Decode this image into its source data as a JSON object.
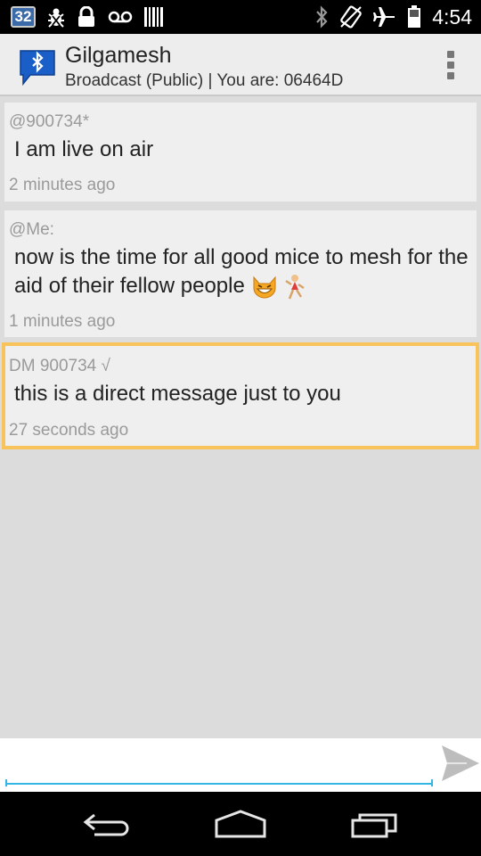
{
  "status_bar": {
    "notification_count": "32",
    "time": "4:54",
    "left_icons": [
      "bug-icon",
      "lock-icon",
      "voicemail-icon",
      "barcode-icon"
    ],
    "right_icons": [
      "bluetooth-icon",
      "no-rotate-icon",
      "airplane-icon",
      "battery-icon"
    ]
  },
  "action_bar": {
    "title": "Gilgamesh",
    "subtitle": "Broadcast (Public) | You are: 06464D",
    "icon": "bluetooth-chat-icon",
    "overflow_icon": "overflow-menu-icon"
  },
  "messages": [
    {
      "sender": "@900734*",
      "text": "I am live on air",
      "time": "2 minutes ago",
      "direct": false
    },
    {
      "sender": "@Me:",
      "text": "now is the time for all good mice to mesh for the aid of their fellow people",
      "emojis": [
        "grinning-cat-emoji",
        "dancer-emoji"
      ],
      "time": "1 minutes ago",
      "direct": false
    },
    {
      "sender": "DM 900734 √",
      "text": "this is a direct message just to you",
      "time": "27 seconds ago",
      "direct": true
    }
  ],
  "composer": {
    "value": "",
    "placeholder": "",
    "send_icon": "send-icon"
  },
  "nav_bar": {
    "icons": [
      "back-icon",
      "home-icon",
      "recents-icon"
    ]
  },
  "colors": {
    "dm_border": "#f7c35a",
    "input_underline": "#33b5e5",
    "app_icon_blue": "#1a5fc8",
    "list_background": "#dcdcdc",
    "card_background": "#efefef"
  }
}
